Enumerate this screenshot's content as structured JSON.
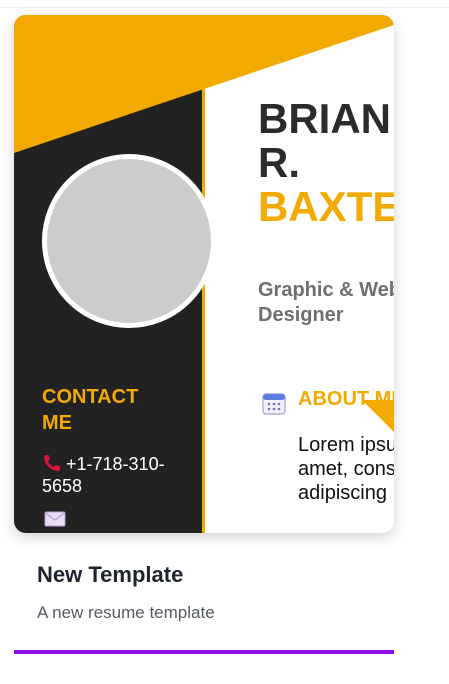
{
  "resume": {
    "first_name": "BRIAN",
    "middle": "R.",
    "last_name": "BAXTER",
    "title": "Graphic & Web Designer",
    "contact_heading": "CONTACT ME",
    "phone": "+1-718-310-5658",
    "about_heading": "ABOUT ME",
    "about_text": "Lorem ipsum dolor sit amet, consectetur adipiscing"
  },
  "template": {
    "name": "New Template",
    "description": "A new resume template"
  },
  "colors": {
    "gold": "#f2a900",
    "dark": "#222222",
    "accent": "#8a10e0"
  },
  "icons": [
    "phone-icon",
    "mail-icon",
    "calendar-icon"
  ]
}
